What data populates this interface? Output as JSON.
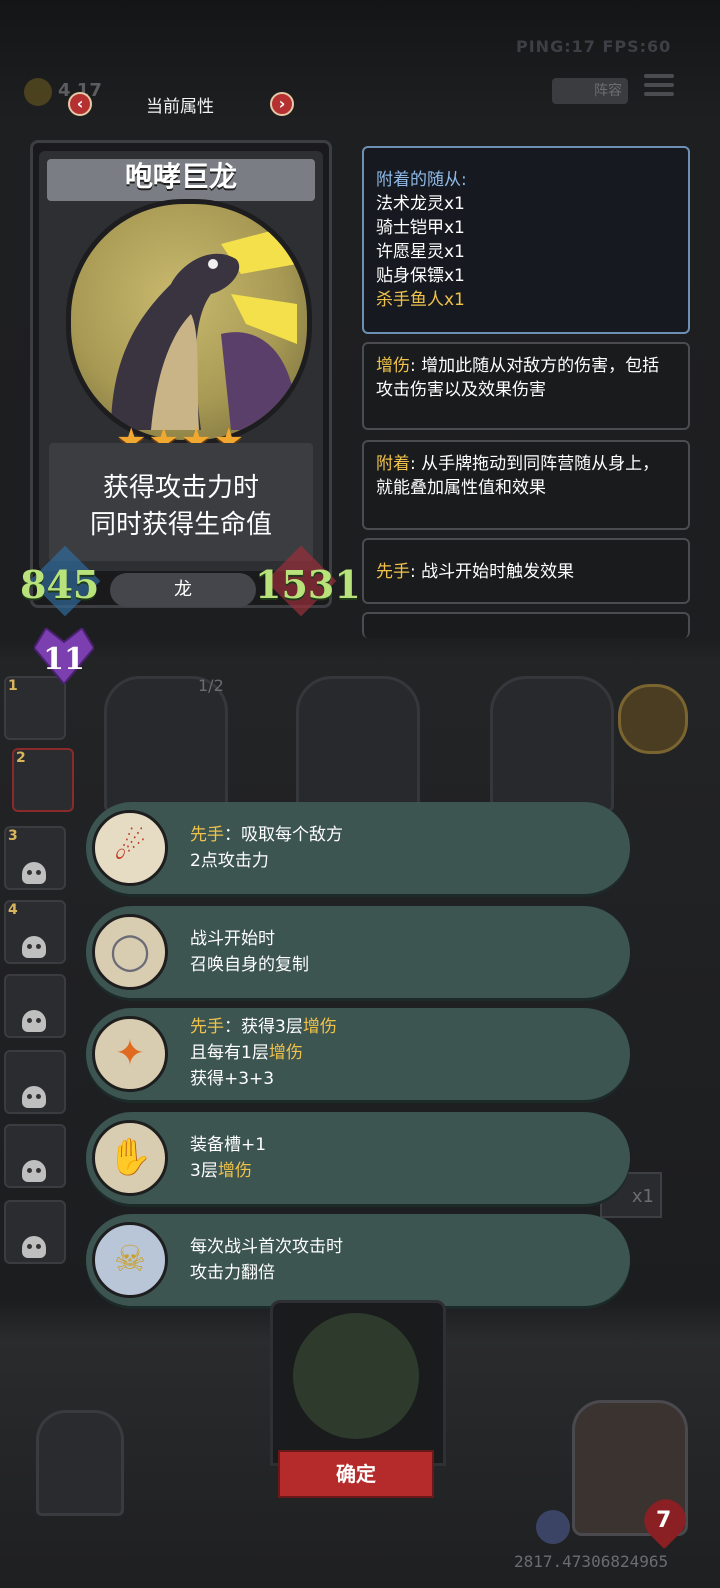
{
  "hud": {
    "ping_fps": "PING:17   FPS:60",
    "gold": "4 17",
    "team_button": "阵容"
  },
  "header": {
    "title": "当前属性",
    "prev": "‹",
    "next": "›"
  },
  "card": {
    "name": "咆哮巨龙",
    "stars": "★★★★",
    "star_count": 4,
    "text_line1": "获得攻击力时",
    "text_line2": "同时获得生命值",
    "attack": "845",
    "health": "1531",
    "tribe": "龙",
    "level": "11"
  },
  "attached": {
    "title": "附着的随从:",
    "items": [
      "法术龙灵x1",
      "骑士铠甲x1",
      "许愿星灵x1",
      "贴身保镖x1",
      "杀手鱼人x1"
    ]
  },
  "keywords": [
    {
      "name": "增伤",
      "text": ": 增加此随从对敌方的伤害，包括攻击伤害以及效果伤害"
    },
    {
      "name": "附着",
      "text": ": 从手牌拖动到同阵营随从身上，就能叠加属性值和效果"
    },
    {
      "name": "先手",
      "text": ": 战斗开始时触发效果"
    }
  ],
  "abilities": [
    {
      "icon": "claws-icon",
      "glyph": "☄",
      "kw": "先手",
      "line1_rest": "：吸取每个敌方",
      "line2": "2点攻击力",
      "line3": ""
    },
    {
      "icon": "mirror-icon",
      "glyph": "◯",
      "kw": "",
      "line1_rest": "战斗开始时",
      "line2": "召唤自身的复制",
      "line3": ""
    },
    {
      "icon": "torch-icon",
      "glyph": "✦",
      "kw": "先手",
      "line1_rest": "：获得3层",
      "line1_kw2": "增伤",
      "line2_pre": "且每有1层",
      "line2_kw": "增伤",
      "line3": "获得+3+3"
    },
    {
      "icon": "gauntlet-icon",
      "glyph": "✋",
      "kw": "",
      "line1_rest": "装备槽+1",
      "line2_pre": "3层",
      "line2_kw": "增伤",
      "line3": ""
    },
    {
      "icon": "beast-icon",
      "glyph": "☠",
      "kw": "",
      "line1_rest": "每次战斗首次攻击时",
      "line2": "攻击力翻倍",
      "line3": ""
    }
  ],
  "board": {
    "turn": "1/2",
    "slot_numbers": [
      "1",
      "2",
      "3",
      "4"
    ],
    "multiplier": "x1",
    "hand_hp": "7"
  },
  "confirm": "确定",
  "score": "2817.47306824965"
}
